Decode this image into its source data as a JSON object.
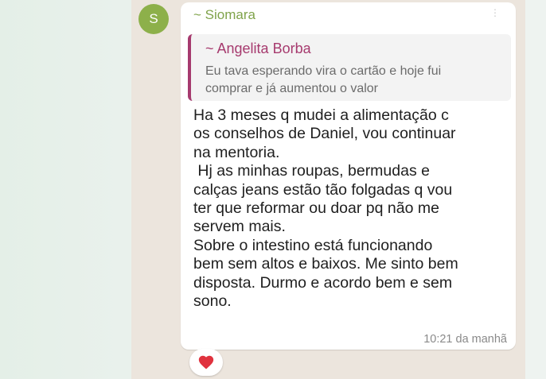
{
  "avatar": {
    "initial": "S",
    "color": "#8db04a"
  },
  "message": {
    "sender": "~ Siomara",
    "sender_color": "#7fa34a",
    "quote": {
      "author": "~ Angelita Borba",
      "author_color": "#a63a6e",
      "text_lines": [
        "Eu tava esperando vira o cartão e hoje fui",
        "comprar e já aumentou o valor"
      ]
    },
    "text_lines": [
      "Ha 3 meses q mudei a alimentação c",
      "os conselhos de Daniel, vou continuar",
      "na mentoria.",
      " Hj as minhas roupas, bermudas e",
      "calças jeans estão tão folgadas q vou",
      "ter que reformar ou doar pq não me",
      "servem mais.",
      "Sobre o intestino está funcionando",
      "bem sem altos e baixos. Me sinto bem",
      "disposta. Durmo e acordo bem e sem",
      "sono."
    ],
    "timestamp": "10:21 da manhã"
  },
  "reaction": {
    "icon": "heart-icon",
    "color": "#e0323e"
  }
}
